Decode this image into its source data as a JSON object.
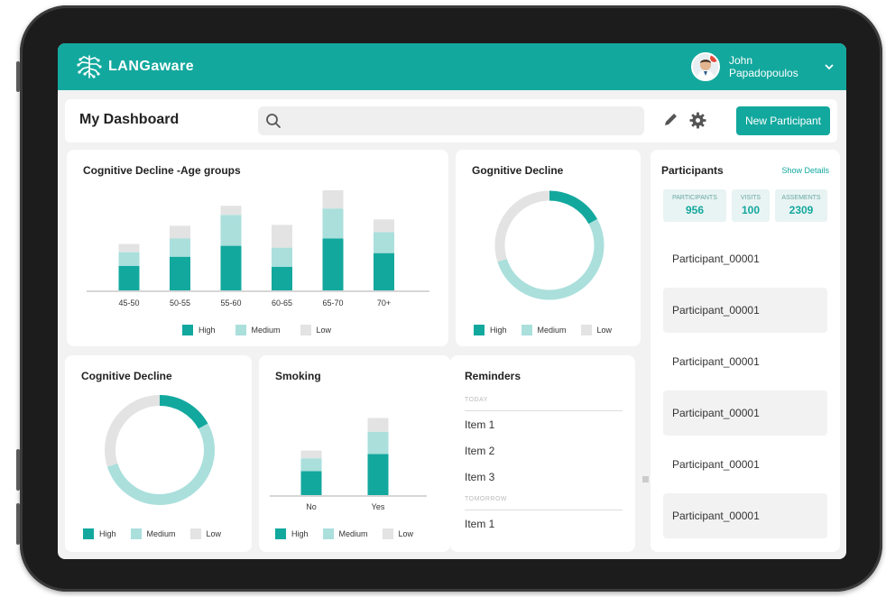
{
  "colors": {
    "accent": "#13a89e",
    "high": "#13a89e",
    "medium": "#aadfdc",
    "low": "#e3e3e3"
  },
  "header": {
    "logo_text": "LANGaware",
    "user_name_line1": "John",
    "user_name_line2": "Papadopoulos"
  },
  "toolbar": {
    "title": "My Dashboard",
    "search_placeholder": "",
    "new_button": "New Participant"
  },
  "legend": {
    "high": "High",
    "medium": "Medium",
    "low": "Low"
  },
  "age_chart": {
    "title": "Cognitive Decline -Age groups",
    "chart_data": {
      "type": "bar",
      "stacked": true,
      "categories": [
        "45-50",
        "50-55",
        "55-60",
        "60-65",
        "65-70",
        "70+"
      ],
      "series": [
        {
          "name": "High",
          "values": [
            27,
            37,
            49,
            26,
            57,
            41
          ]
        },
        {
          "name": "Medium",
          "values": [
            15,
            20,
            34,
            21,
            33,
            23
          ]
        },
        {
          "name": "Low",
          "values": [
            9,
            14,
            10,
            25,
            20,
            14
          ]
        }
      ],
      "ylim": [
        0,
        115
      ]
    }
  },
  "donut_top": {
    "title": "Gognitive Decline",
    "chart_data": {
      "type": "pie",
      "donut": true,
      "labels": [
        "High",
        "Medium",
        "Low"
      ],
      "values": [
        17,
        53,
        30
      ]
    }
  },
  "donut_bottom": {
    "title": "Cognitive Decline",
    "chart_data": {
      "type": "pie",
      "donut": true,
      "labels": [
        "High",
        "Medium",
        "Low"
      ],
      "values": [
        17,
        53,
        30
      ]
    }
  },
  "smoking": {
    "title": "Smoking",
    "chart_data": {
      "type": "bar",
      "stacked": true,
      "categories": [
        "No",
        "Yes"
      ],
      "series": [
        {
          "name": "High",
          "values": [
            28,
            48
          ]
        },
        {
          "name": "Medium",
          "values": [
            15,
            26
          ]
        },
        {
          "name": "Low",
          "values": [
            9,
            16
          ]
        }
      ],
      "ylim": [
        0,
        100
      ]
    }
  },
  "reminders": {
    "title": "Reminders",
    "today_label": "TODAY",
    "today_items": [
      "Item 1",
      "Item 2",
      "Item 3"
    ],
    "tomorrow_label": "TOMORROW",
    "tomorrow_items": [
      "Item 1"
    ]
  },
  "participants": {
    "title": "Participants",
    "show_details": "Show Details",
    "stats": [
      {
        "label": "PARTICIPANTS",
        "value": "956"
      },
      {
        "label": "VISITS",
        "value": "100"
      },
      {
        "label": "ASSEMENTS",
        "value": "2309"
      }
    ],
    "items": [
      "Participant_00001",
      "Participant_00001",
      "Participant_00001",
      "Participant_00001",
      "Participant_00001",
      "Participant_00001"
    ]
  }
}
